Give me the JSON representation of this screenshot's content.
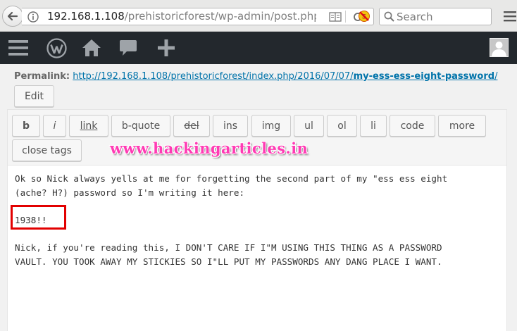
{
  "browser": {
    "url_host": "192.168.1.108",
    "url_path": "/prehistoricforest/wp-admin/post.php?p",
    "search_placeholder": "Search"
  },
  "permalink": {
    "label": "Permalink:",
    "url_prefix": "http://192.168.1.108/prehistoricforest/index.php/2016/07/07/",
    "url_slug": "my-ess-ess-eight-password",
    "url_suffix": "/",
    "edit_label": "Edit"
  },
  "toolbar": {
    "buttons": [
      "b",
      "i",
      "link",
      "b-quote",
      "del",
      "ins",
      "img",
      "ul",
      "ol",
      "li",
      "code",
      "more",
      "close tags"
    ]
  },
  "watermark": "www.hackingarticles.in",
  "content": {
    "line1": "Ok so Nick always yells at me for forgetting the second part of my \"ess ess eight",
    "line2": "(ache? H?) password so I'm writing it here:",
    "line3": "1938!!",
    "line4": "Nick, if you're reading this, I DON'T CARE IF I\"M USING THIS THING AS A PASSWORD",
    "line5": "VAULT. YOU TOOK AWAY MY STICKIES SO I\"LL PUT MY PASSWORDS ANY DANG PLACE I WANT."
  },
  "colors": {
    "admin_bar": "#23282d",
    "link": "#0073aa",
    "highlight": "#e20000",
    "watermark": "#ff3bb4"
  }
}
